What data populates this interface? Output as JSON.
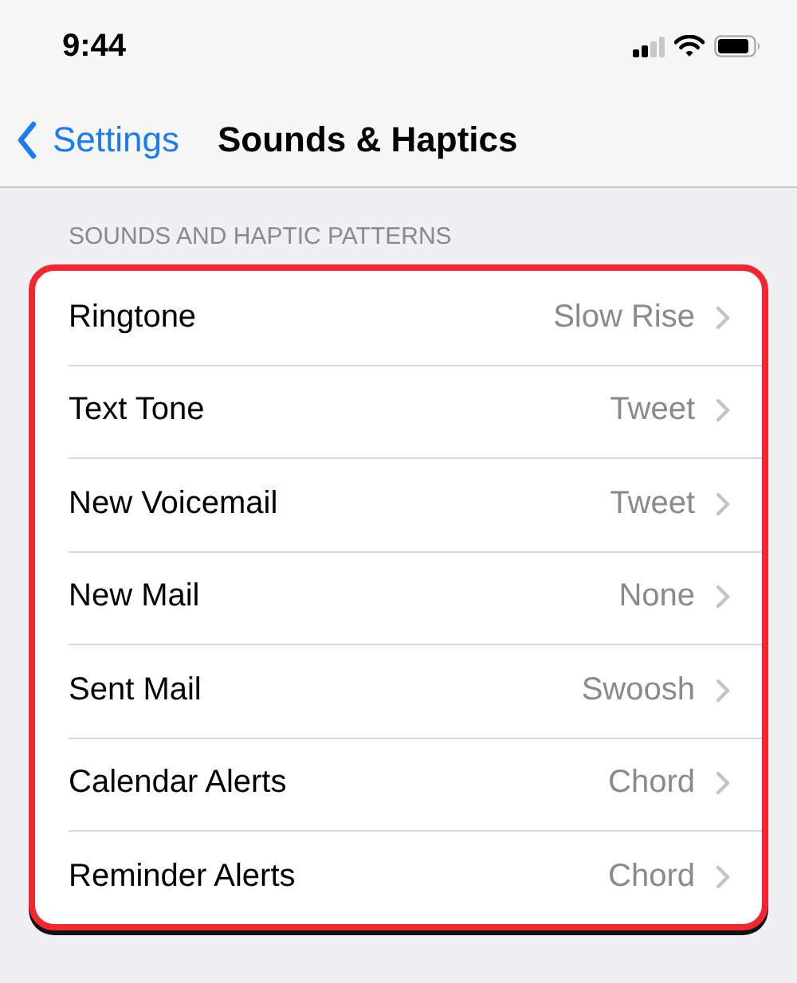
{
  "status_bar": {
    "time": "9:44"
  },
  "nav_bar": {
    "back_label": "Settings",
    "title": "Sounds & Haptics"
  },
  "section": {
    "header": "SOUNDS AND HAPTIC PATTERNS",
    "highlighted": true,
    "rows": [
      {
        "label": "Ringtone",
        "value": "Slow Rise"
      },
      {
        "label": "Text Tone",
        "value": "Tweet"
      },
      {
        "label": "New Voicemail",
        "value": "Tweet"
      },
      {
        "label": "New Mail",
        "value": "None"
      },
      {
        "label": "Sent Mail",
        "value": "Swoosh"
      },
      {
        "label": "Calendar Alerts",
        "value": "Chord"
      },
      {
        "label": "Reminder Alerts",
        "value": "Chord"
      }
    ]
  }
}
